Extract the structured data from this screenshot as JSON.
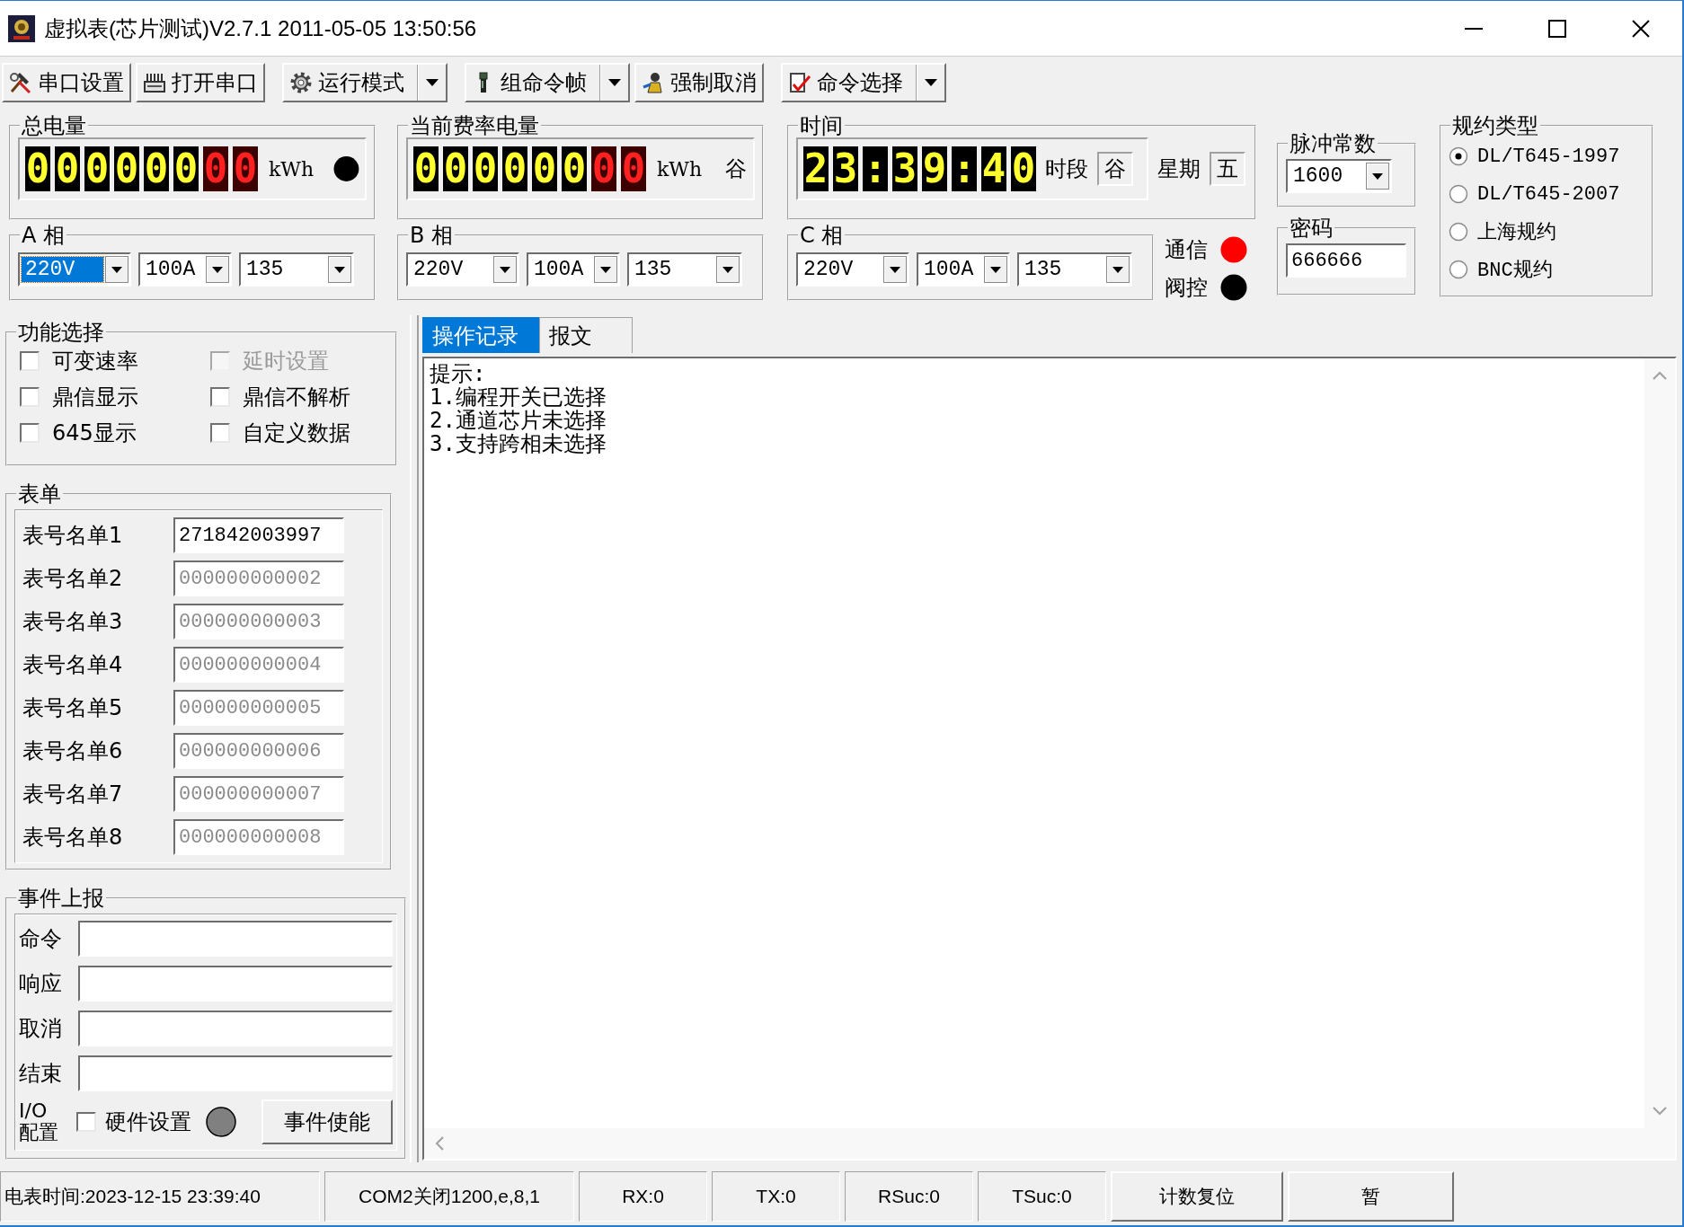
{
  "window": {
    "title": "虚拟表(芯片测试)V2.7.1 2011-05-05 13:50:56"
  },
  "toolbar": [
    {
      "label": "串口设置",
      "kind": "button"
    },
    {
      "label": "打开串口",
      "kind": "button"
    },
    {
      "label": "运行模式",
      "kind": "dropdown"
    },
    {
      "label": "组命令帧",
      "kind": "dropdown"
    },
    {
      "label": "强制取消",
      "kind": "button"
    },
    {
      "label": "命令选择",
      "kind": "dropdown"
    }
  ],
  "total_energy": {
    "title": "总电量",
    "integer": "000000",
    "decimal": "00",
    "unit": "kWh"
  },
  "current_rate_energy": {
    "title": "当前费率电量",
    "integer": "000000",
    "decimal": "00",
    "unit": "kWh",
    "rate": "谷"
  },
  "time": {
    "title": "时间",
    "value": "23:39:40",
    "period_label": "时段",
    "period": "谷",
    "weekday_label": "星期",
    "weekday": "五"
  },
  "phases": [
    {
      "title": "A 相",
      "voltage": "220V",
      "current": "100A",
      "combo_3": "135",
      "focused": true
    },
    {
      "title": "B 相",
      "voltage": "220V",
      "current": "100A",
      "combo_3": "135",
      "focused": false
    },
    {
      "title": "C 相",
      "voltage": "220V",
      "current": "100A",
      "combo_3": "135",
      "focused": false
    }
  ],
  "signals": [
    {
      "label": "通信",
      "color": "#ff0000"
    },
    {
      "label": "阀控",
      "color": "#000000"
    }
  ],
  "pulse_constant": {
    "title": "脉冲常数",
    "value": "1600"
  },
  "password": {
    "title": "密码",
    "value": "666666"
  },
  "protocol": {
    "title": "规约类型",
    "options": [
      {
        "label": "DL/T645-1997",
        "selected": true
      },
      {
        "label": "DL/T645-2007",
        "selected": false
      },
      {
        "label": "上海规约",
        "selected": false
      },
      {
        "label": "BNC规约",
        "selected": false
      }
    ]
  },
  "functions": {
    "title": "功能选择",
    "options": [
      {
        "label": "可变速率",
        "checked": false,
        "disabled": false
      },
      {
        "label": "延时设置",
        "checked": false,
        "disabled": true
      },
      {
        "label": "鼎信显示",
        "checked": false,
        "disabled": false
      },
      {
        "label": "鼎信不解析",
        "checked": false,
        "disabled": false
      },
      {
        "label": "645显示",
        "checked": false,
        "disabled": false
      },
      {
        "label": "自定义数据",
        "checked": false,
        "disabled": false
      }
    ]
  },
  "meter_list": {
    "title": "表单",
    "rows": [
      {
        "label": "表号名单1",
        "value": "271842003997",
        "disabled": false
      },
      {
        "label": "表号名单2",
        "value": "000000000002",
        "disabled": true
      },
      {
        "label": "表号名单3",
        "value": "000000000003",
        "disabled": true
      },
      {
        "label": "表号名单4",
        "value": "000000000004",
        "disabled": true
      },
      {
        "label": "表号名单5",
        "value": "000000000005",
        "disabled": true
      },
      {
        "label": "表号名单6",
        "value": "000000000006",
        "disabled": true
      },
      {
        "label": "表号名单7",
        "value": "000000000007",
        "disabled": true
      },
      {
        "label": "表号名单8",
        "value": "000000000008",
        "disabled": true
      }
    ]
  },
  "event_report": {
    "title": "事件上报",
    "fields": [
      {
        "label": "命令"
      },
      {
        "label": "响应"
      },
      {
        "label": "取消"
      },
      {
        "label": "结束"
      }
    ],
    "io_label": "I/O 配置",
    "hardware": {
      "label": "硬件设置",
      "checked": false
    },
    "button": "事件使能"
  },
  "log": {
    "tabs": [
      {
        "label": "操作记录",
        "selected": true
      },
      {
        "label": "报文",
        "selected": false
      }
    ],
    "lines": [
      "提示:",
      "1.编程开关已选择",
      "2.通道芯片未选择",
      "3.支持跨相未选择"
    ]
  },
  "status_bar": [
    {
      "text": "电表时间:2023-12-15 23:39:40",
      "kind": "text"
    },
    {
      "text": "COM2关闭1200,e,8,1",
      "kind": "text"
    },
    {
      "text": "RX:0",
      "kind": "text"
    },
    {
      "text": "TX:0",
      "kind": "text"
    },
    {
      "text": "RSuc:0",
      "kind": "text"
    },
    {
      "text": "TSuc:0",
      "kind": "text"
    },
    {
      "text": "计数复位",
      "kind": "button"
    },
    {
      "text": "暂",
      "kind": "button"
    }
  ]
}
